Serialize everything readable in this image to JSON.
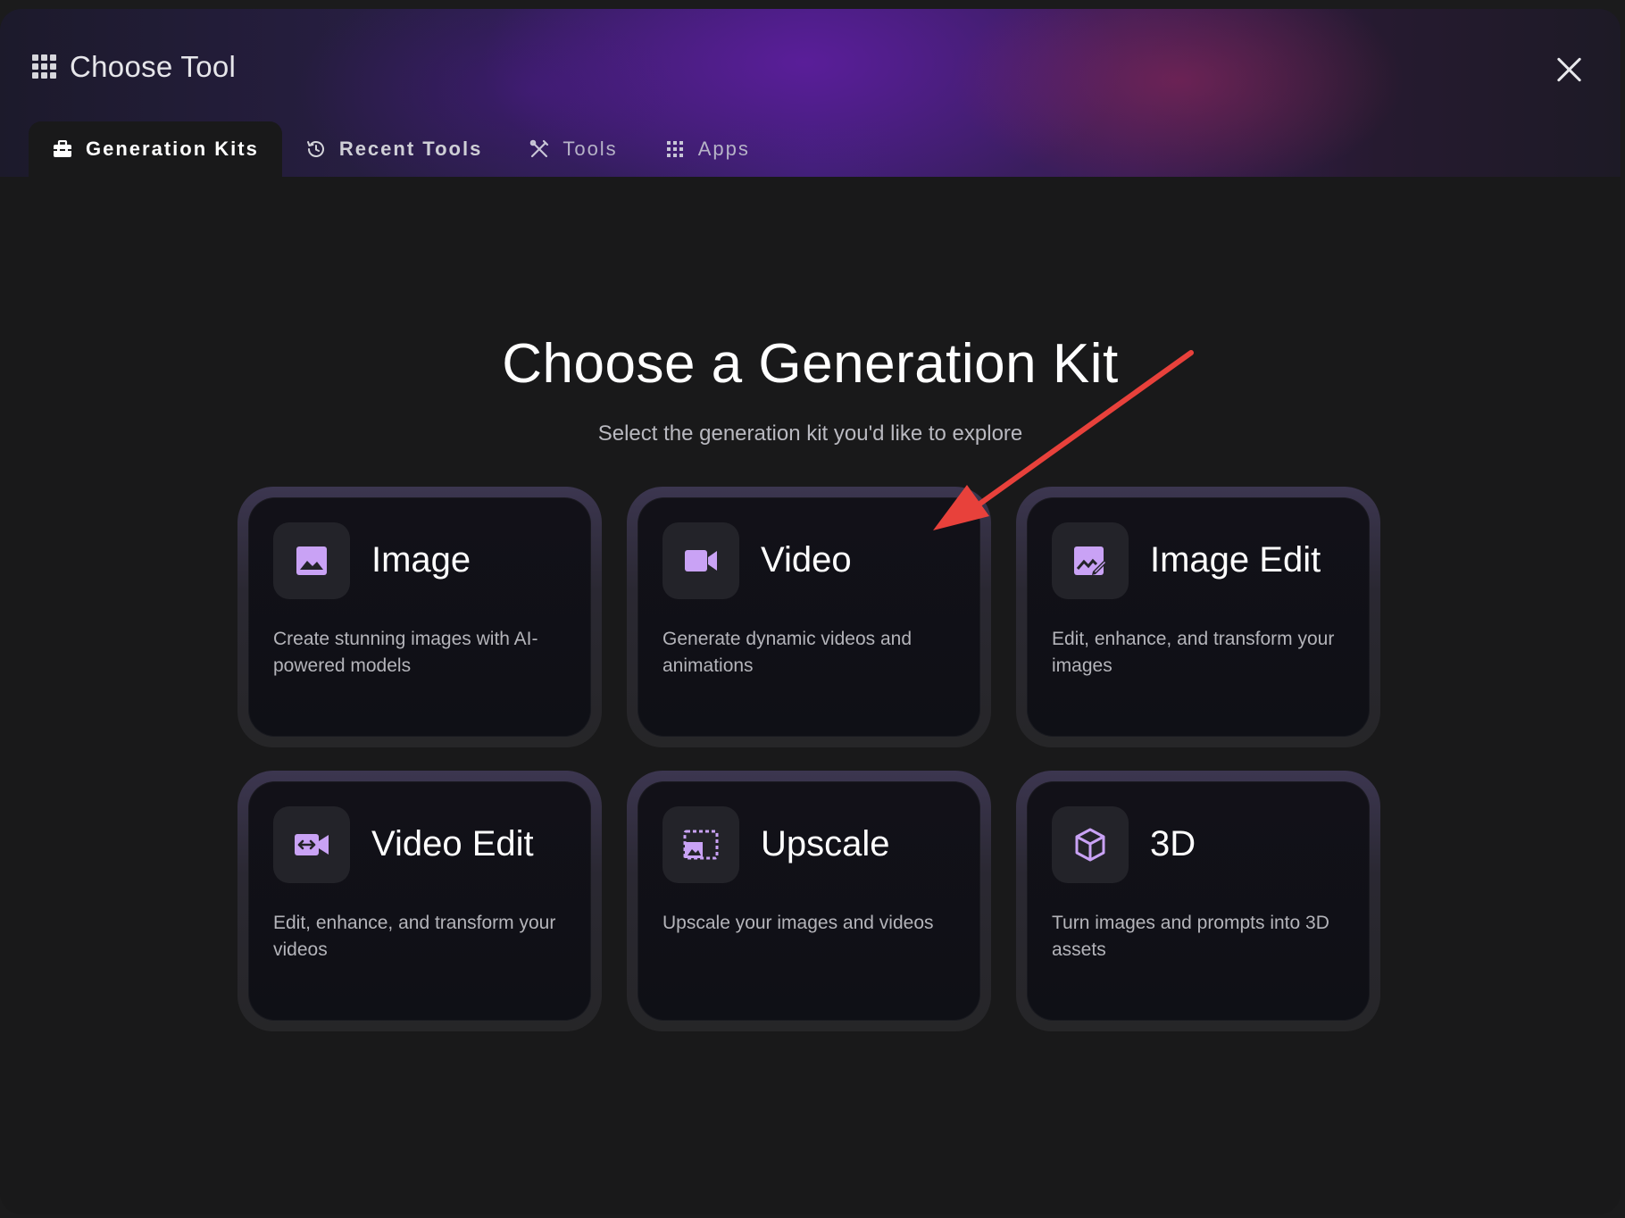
{
  "window": {
    "title": "Choose Tool",
    "title_icon": "grid-icon",
    "close_icon": "close-icon"
  },
  "tabs": [
    {
      "label": "Generation Kits",
      "icon": "toolbox-icon",
      "active": true
    },
    {
      "label": "Recent Tools",
      "icon": "history-icon",
      "active": false
    },
    {
      "label": "Tools",
      "icon": "tools-icon",
      "active": false
    },
    {
      "label": "Apps",
      "icon": "grid-icon",
      "active": false
    }
  ],
  "main": {
    "heading": "Choose a Generation Kit",
    "subheading": "Select the generation kit you'd like to explore"
  },
  "kits": [
    {
      "title": "Image",
      "icon": "image-icon",
      "description": "Create stunning images with AI-powered models"
    },
    {
      "title": "Video",
      "icon": "video-camera-icon",
      "description": "Generate dynamic videos and animations"
    },
    {
      "title": "Image Edit",
      "icon": "image-edit-icon",
      "description": "Edit, enhance, and transform your images"
    },
    {
      "title": "Video Edit",
      "icon": "video-edit-icon",
      "description": "Edit, enhance, and transform your videos"
    },
    {
      "title": "Upscale",
      "icon": "upscale-icon",
      "description": "Upscale your images and videos"
    },
    {
      "title": "3D",
      "icon": "cube-icon",
      "description": "Turn images and prompts into 3D assets"
    }
  ],
  "colors": {
    "accent_icon": "#c9a2f5",
    "annotation_arrow": "#e8413b",
    "background": "#19191a"
  }
}
